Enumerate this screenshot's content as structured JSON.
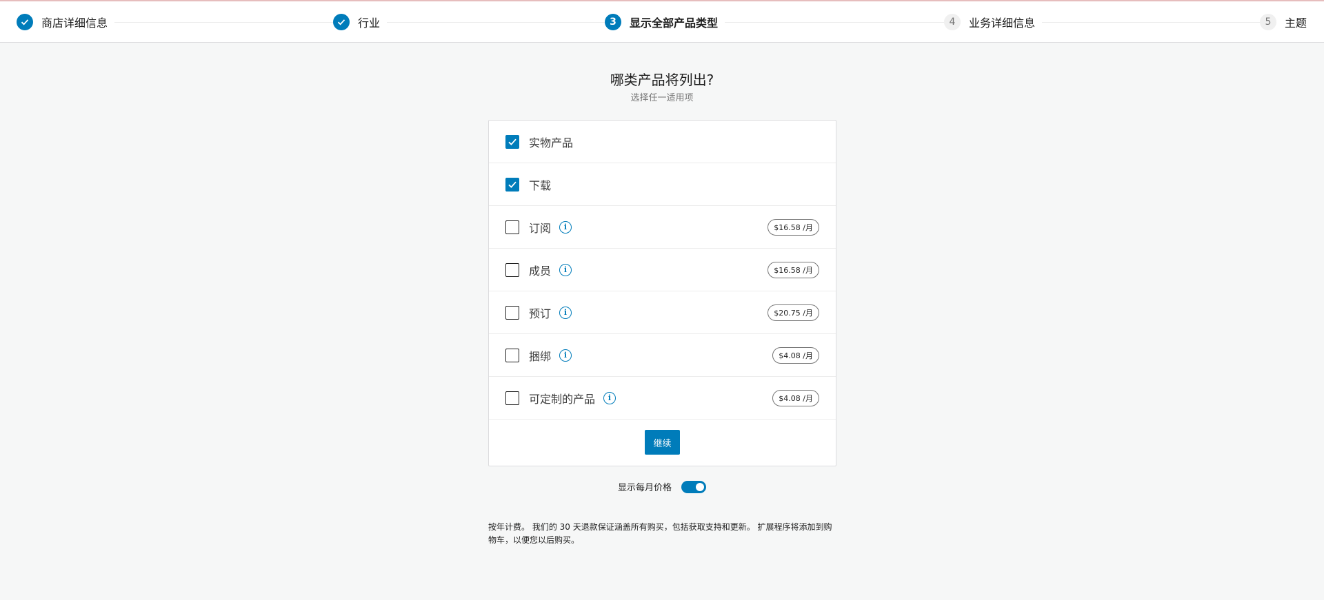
{
  "stepper": {
    "steps": [
      {
        "label": "商店详细信息",
        "state": "done",
        "number": ""
      },
      {
        "label": "行业",
        "state": "done",
        "number": ""
      },
      {
        "label": "显示全部产品类型",
        "state": "current",
        "number": "3"
      },
      {
        "label": "业务详细信息",
        "state": "todo",
        "number": "4"
      },
      {
        "label": "主题",
        "state": "todo",
        "number": "5"
      }
    ]
  },
  "header": {
    "title": "哪类产品将列出?",
    "subtitle": "选择任一适用项"
  },
  "products": [
    {
      "label": "实物产品",
      "checked": true,
      "info": false,
      "price": ""
    },
    {
      "label": "下载",
      "checked": true,
      "info": false,
      "price": ""
    },
    {
      "label": "订阅",
      "checked": false,
      "info": true,
      "price": "$16.58 /月"
    },
    {
      "label": "成员",
      "checked": false,
      "info": true,
      "price": "$16.58 /月"
    },
    {
      "label": "预订",
      "checked": false,
      "info": true,
      "price": "$20.75 /月"
    },
    {
      "label": "捆绑",
      "checked": false,
      "info": true,
      "price": "$4.08 /月"
    },
    {
      "label": "可定制的产品",
      "checked": false,
      "info": true,
      "price": "$4.08 /月"
    }
  ],
  "continue_label": "继续",
  "monthly_toggle": {
    "label": "显示每月价格",
    "on": true
  },
  "note": "按年计费。 我们的 30 天退款保证涵盖所有购买，包括获取支持和更新。 扩展程序将添加到购物车，以便您以后购买。",
  "colors": {
    "accent": "#007cba"
  }
}
